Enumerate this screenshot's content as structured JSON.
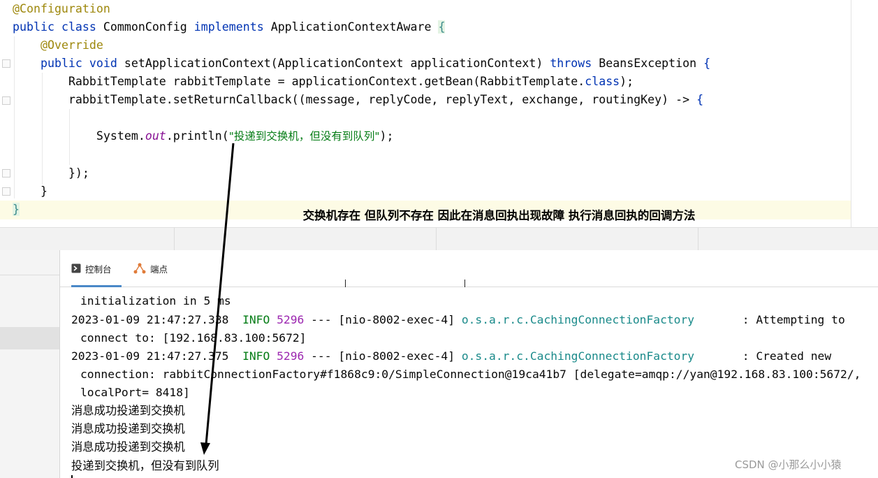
{
  "editor": {
    "line1_annotation": "@Configuration",
    "line2_kw_public": "public",
    "line2_kw_class": "class",
    "line2_name": "CommonConfig",
    "line2_kw_implements": "implements",
    "line2_iface": "ApplicationContextAware",
    "line2_brace": "{",
    "line3_override": "@Override",
    "line4_kw_public": "public",
    "line4_kw_void": "void",
    "line4_method": "setApplicationContext(ApplicationContext applicationContext)",
    "line4_kw_throws": "throws",
    "line4_exception": "BeansException",
    "line4_brace": "{",
    "line5_a": "RabbitTemplate rabbitTemplate = applicationContext.getBean(RabbitTemplate.",
    "line5_kw_class": "class",
    "line5_b": ");",
    "line6_a": "rabbitTemplate.setReturnCallback((message, replyCode, replyText, exchange, routingKey) -> ",
    "line6_brace": "{",
    "line8_system": "System.",
    "line8_out": "out",
    "line8_println": ".println(",
    "line8_string": "\"投递到交换机，但没有到队列\"",
    "line8_end": ");",
    "line10": "});",
    "line11": "}",
    "line12": "}"
  },
  "annotation_text": "交换机存在 但队列不存在 因此在消息回执出现故障 执行消息回执的回调方法",
  "tabs": [
    {
      "label": "控制台",
      "icon": "console-icon"
    },
    {
      "label": "端点",
      "icon": "endpoints-icon"
    }
  ],
  "console": {
    "line0": "initialization in 5 ms",
    "log1": {
      "timestamp": "2023-01-09 21:47:27.338",
      "level": "INFO",
      "pid": "5296",
      "sep": "---",
      "thread": "[nio-8002-exec-4]",
      "logger": "o.s.a.r.c.CachingConnectionFactory",
      "message": ": Attempting to",
      "cont": "connect to: [192.168.83.100:5672]"
    },
    "log2": {
      "timestamp": "2023-01-09 21:47:27.375",
      "level": "INFO",
      "pid": "5296",
      "sep": "---",
      "thread": "[nio-8002-exec-4]",
      "logger": "o.s.a.r.c.CachingConnectionFactory",
      "message": ": Created new",
      "cont1": "connection: rabbitConnectionFactory#f1868c9:0/SimpleConnection@19ca41b7 [delegate=amqp://yan@192.168.83.100:5672/,",
      "cont2": "localPort= 8418]"
    },
    "messages": [
      "消息成功投递到交换机",
      "消息成功投递到交换机",
      "消息成功投递到交换机",
      "投递到交换机，但没有到队列"
    ]
  },
  "watermark": "CSDN @小那么小小猿",
  "colors": {
    "keyword": "#0033b3",
    "annotation": "#9e880d",
    "string": "#067d17",
    "logger": "#1a8a8a",
    "pid": "#9c27b0",
    "tab_underline": "#4a88c7"
  }
}
